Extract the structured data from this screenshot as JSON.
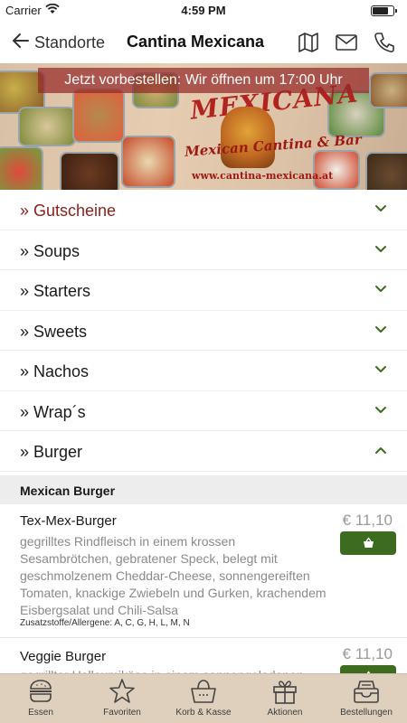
{
  "status_bar": {
    "carrier": "Carrier",
    "time": "4:59 PM",
    "battery_level": 0.8
  },
  "nav": {
    "back_label": "Standorte",
    "title": "Cantina Mexicana"
  },
  "banner": {
    "notice": "Jetzt vorbestellen: Wir öffnen um 17:00 Uhr",
    "logo_title": "MEXICANA",
    "logo_tagline": "Mexican Cantina & Bar",
    "logo_url": "www.cantina-mexicana.at"
  },
  "categories": [
    {
      "label": "» Gutscheine",
      "expanded": false
    },
    {
      "label": "» Soups",
      "expanded": false
    },
    {
      "label": "» Starters",
      "expanded": false
    },
    {
      "label": "» Sweets",
      "expanded": false
    },
    {
      "label": "» Nachos",
      "expanded": false
    },
    {
      "label": "» Wrap´s",
      "expanded": false
    },
    {
      "label": "» Burger",
      "expanded": true
    }
  ],
  "section": {
    "label": "Mexican Burger"
  },
  "items": [
    {
      "name": "Tex-Mex-Burger",
      "description": "gegrilltes Rindfleisch in einem krossen Sesambrötchen, gebratener Speck, belegt mit geschmolzenem Cheddar-Cheese, sonnengereiften Tomaten, knackige Zwiebeln und Gurken, krachendem Eisbergsalat und Chili-Salsa",
      "allergens": "Zusatzstoffe/Allergene: A, C, G, H, L, M, N",
      "price": "€ 11,10"
    },
    {
      "name": "Veggie Burger",
      "description": "gegrillter Halloumikäse in einem sonnengeladenen",
      "allergens": "",
      "price": "€ 11,10"
    }
  ],
  "tabs": [
    {
      "label": "Essen",
      "icon": "burger-icon"
    },
    {
      "label": "Favoriten",
      "icon": "star-icon"
    },
    {
      "label": "Korb & Kasse",
      "icon": "basket-icon"
    },
    {
      "label": "Aktionen",
      "icon": "gift-icon"
    },
    {
      "label": "Bestellungen",
      "icon": "orders-icon"
    }
  ],
  "colors": {
    "accent_red": "#8c1c18",
    "accent_green": "#3d6b1f",
    "tab_bar_bg": "#ded0bd",
    "section_bg": "#ededed"
  }
}
